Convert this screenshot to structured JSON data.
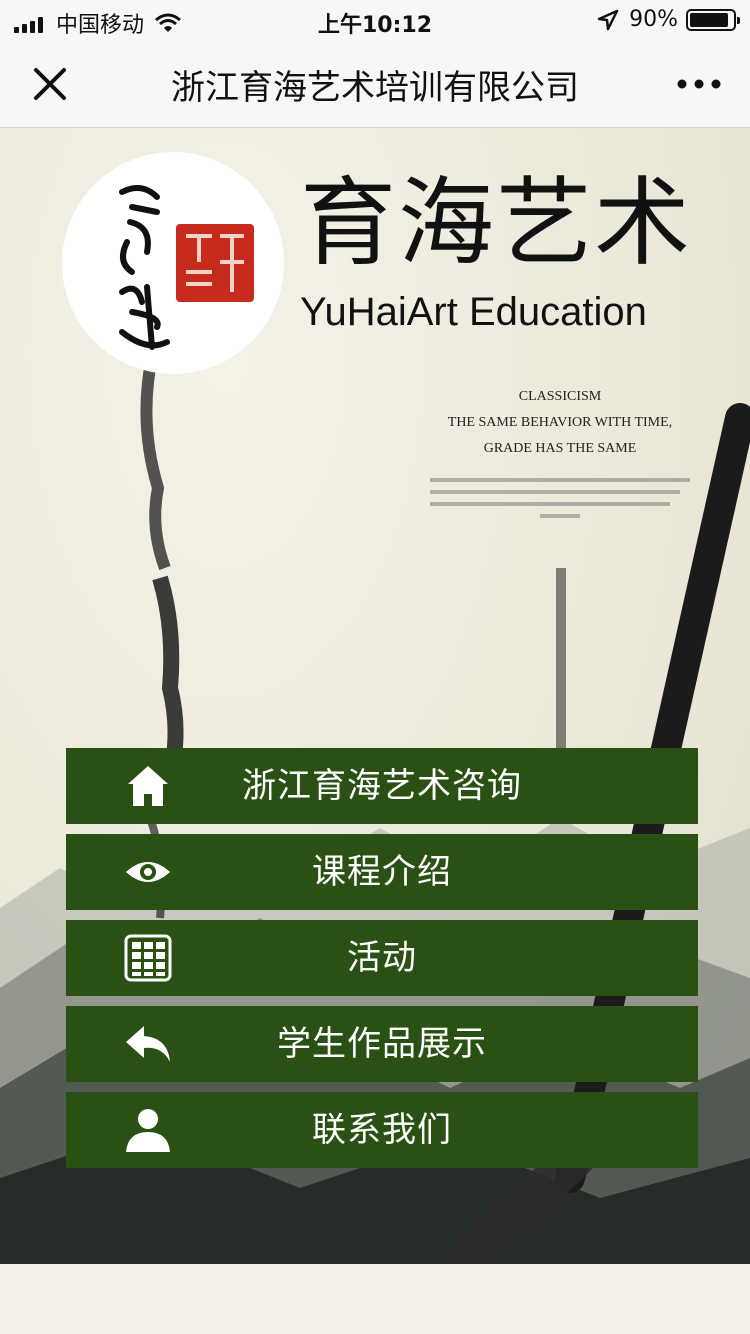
{
  "status_bar": {
    "carrier": "中国移动",
    "time": "上午10:12",
    "battery": "90%",
    "battery_level": 0.9
  },
  "nav": {
    "title": "浙江育海艺术培训有限公司",
    "close_icon": "close-icon",
    "more_icon": "more-icon"
  },
  "header": {
    "brand_title": "育海艺术",
    "brand_subtitle": "YuHaiArt Education",
    "poster_lines": [
      "CLASSICISM",
      "THE SAME BEHAVIOR WITH TIME,",
      "GRADE HAS THE SAME"
    ]
  },
  "menu": {
    "items": [
      {
        "label": "浙江育海艺术咨询",
        "icon": "home-icon"
      },
      {
        "label": "课程介绍",
        "icon": "eye-icon"
      },
      {
        "label": "活动",
        "icon": "grid-icon"
      },
      {
        "label": "学生作品展示",
        "icon": "reply-icon"
      },
      {
        "label": "联系我们",
        "icon": "user-icon"
      }
    ]
  },
  "colors": {
    "menu_bg": "#2a5014",
    "menu_text": "#ffffff",
    "nav_bg": "#f7f7f7",
    "seal_red": "#c62b1e"
  }
}
